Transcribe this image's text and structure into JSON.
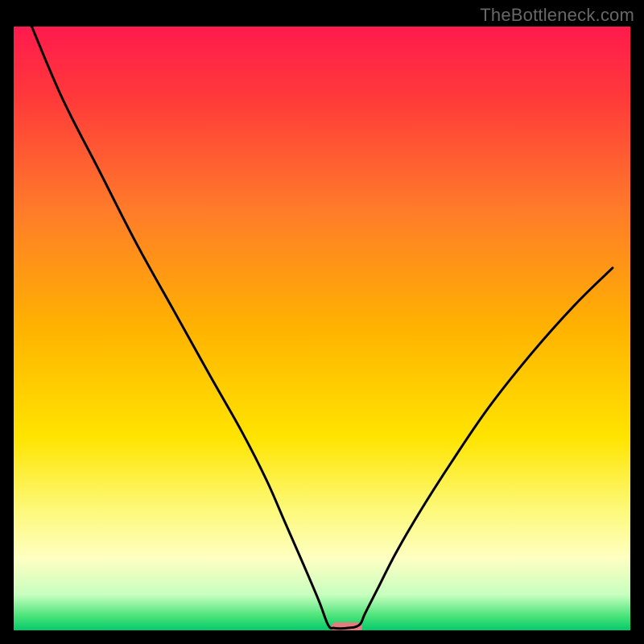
{
  "watermark": "TheBottleneck.com",
  "chart_data": {
    "type": "line",
    "title": "",
    "xlabel": "",
    "ylabel": "",
    "xlim": [
      0,
      100
    ],
    "ylim": [
      0,
      100
    ],
    "background": {
      "type": "vertical-gradient",
      "stops": [
        {
          "offset": 0.0,
          "color": "#ff1a4d"
        },
        {
          "offset": 0.12,
          "color": "#ff3a3a"
        },
        {
          "offset": 0.3,
          "color": "#ff7a2a"
        },
        {
          "offset": 0.5,
          "color": "#ffb300"
        },
        {
          "offset": 0.68,
          "color": "#ffe400"
        },
        {
          "offset": 0.8,
          "color": "#fdf97a"
        },
        {
          "offset": 0.88,
          "color": "#feffc2"
        },
        {
          "offset": 0.94,
          "color": "#c7ffbf"
        },
        {
          "offset": 0.975,
          "color": "#4be37a"
        },
        {
          "offset": 1.0,
          "color": "#00c96a"
        }
      ]
    },
    "series": [
      {
        "name": "bottleneck-curve",
        "x": [
          3,
          8,
          14,
          20,
          26,
          32,
          37,
          41,
          44,
          47,
          49.5,
          51,
          52,
          54,
          56,
          57,
          59,
          62,
          66,
          71,
          77,
          84,
          91,
          97
        ],
        "y": [
          100,
          88,
          76,
          64,
          53,
          42,
          33,
          25,
          18,
          11,
          5,
          1,
          0.5,
          0.5,
          1,
          3,
          7,
          13,
          20,
          28,
          37,
          46,
          54,
          60
        ],
        "stroke": "#000000",
        "stroke_width": 3
      }
    ],
    "marker": {
      "name": "sweet-spot",
      "x_range": [
        51.5,
        56.5
      ],
      "y": 0.6,
      "color": "#e77c7c",
      "shape": "rounded-rect"
    },
    "frame": {
      "stroke": "#000000",
      "inset_top": 32,
      "inset_left": 16,
      "inset_right": 16,
      "inset_bottom": 16
    }
  }
}
